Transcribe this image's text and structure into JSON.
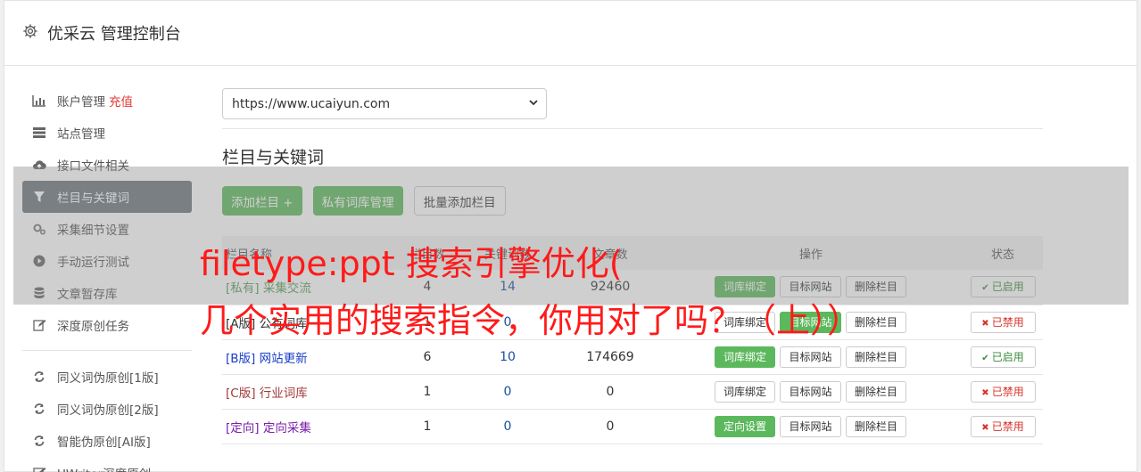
{
  "header": {
    "title": "优采云 管理控制台"
  },
  "sidebar": {
    "items": [
      {
        "label": "账户管理",
        "accent": "充值",
        "icon": "bar-chart-icon",
        "active": false
      },
      {
        "label": "站点管理",
        "icon": "server-icon",
        "active": false
      },
      {
        "label": "接口文件相关",
        "icon": "cloud-upload-icon",
        "active": false
      },
      {
        "label": "栏目与关键词",
        "icon": "filter-icon",
        "active": true
      },
      {
        "label": "采集细节设置",
        "icon": "gears-icon",
        "active": false
      },
      {
        "label": "手动运行测试",
        "icon": "play-circle-icon",
        "active": false
      },
      {
        "label": "文章暂存库",
        "icon": "database-icon",
        "active": false
      },
      {
        "label": "深度原创任务",
        "icon": "edit-icon",
        "active": false
      }
    ],
    "items2": [
      {
        "label": "同义词伪原创[1版]",
        "icon": "refresh-icon"
      },
      {
        "label": "同义词伪原创[2版]",
        "icon": "refresh-icon"
      },
      {
        "label": "智能伪原创[AI版]",
        "icon": "refresh-icon"
      },
      {
        "label": "UWriter深度原创",
        "icon": "edit-icon"
      }
    ]
  },
  "main": {
    "site_select": "https://www.ucaiyun.com",
    "section_title": "栏目与关键词",
    "buttons": {
      "add": "添加栏目 +",
      "private": "私有词库管理",
      "batch": "批量添加栏目"
    },
    "table": {
      "headers": [
        "栏目名称",
        "栏目数",
        "关键词数",
        "文章数",
        "操作",
        "状态"
      ],
      "rows": [
        {
          "name": "[私有] 采集交流",
          "color": "#5a9a5a",
          "c1": "4",
          "c2": "14",
          "c3": "92460",
          "op1": "词库绑定",
          "op1_green": true,
          "op2": "目标网站",
          "op2_green": false,
          "op3": "删除栏目",
          "status": "已启用",
          "enabled": true
        },
        {
          "name": "[A版] 公有词库",
          "color": "#333333",
          "c1": "1",
          "c2": "0",
          "c3": "",
          "op1": "词库绑定",
          "op1_green": false,
          "op2": "目标网站",
          "op2_green": true,
          "op3": "删除栏目",
          "status": "已禁用",
          "enabled": false
        },
        {
          "name": "[B版] 网站更新",
          "color": "#1a3fc8",
          "c1": "6",
          "c2": "10",
          "c3": "174669",
          "op1": "词库绑定",
          "op1_green": true,
          "op2": "目标网站",
          "op2_green": false,
          "op3": "删除栏目",
          "status": "已启用",
          "enabled": true
        },
        {
          "name": "[C版] 行业词库",
          "color": "#a33a3a",
          "c1": "1",
          "c2": "0",
          "c3": "0",
          "op1": "词库绑定",
          "op1_green": false,
          "op2": "目标网站",
          "op2_green": false,
          "op3": "删除栏目",
          "status": "已禁用",
          "enabled": false
        },
        {
          "name": "[定向] 定向采集",
          "color": "#7a1fa8",
          "c1": "1",
          "c2": "0",
          "c3": "0",
          "op1": "定向设置",
          "op1_green": true,
          "op2": "目标网站",
          "op2_green": false,
          "op3": "删除栏目",
          "status": "已禁用",
          "enabled": false
        }
      ]
    }
  },
  "watermark": {
    "line1": "filetype:ppt 搜索引擎优化(",
    "line2": "几个实用的搜索指令，你用对了吗？（上））"
  },
  "colors": {
    "green": "#5cb85c",
    "active_nav": "#6c757d",
    "danger": "#e53935",
    "watermark": "#ff1a1a"
  }
}
